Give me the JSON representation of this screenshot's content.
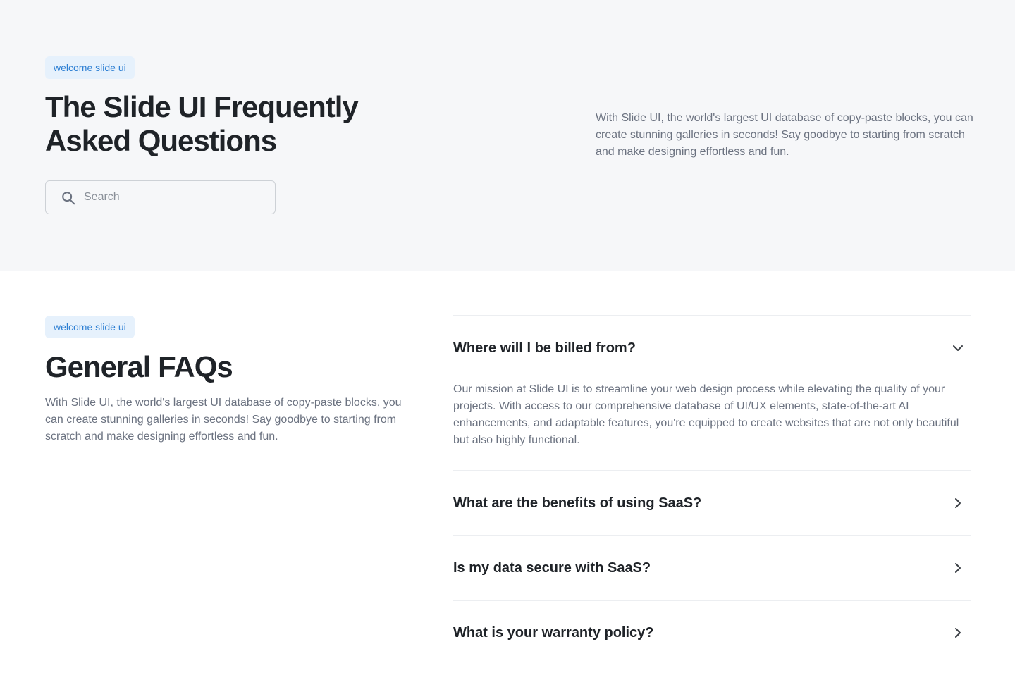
{
  "hero": {
    "badge": "welcome slide ui",
    "title": "The Slide UI Frequently Asked Questions",
    "search_placeholder": "Search",
    "description": "With Slide UI, the world's largest UI database of copy-paste blocks, you can create stunning galleries in seconds! Say goodbye to starting from scratch and make designing effortless and fun."
  },
  "faq_section": {
    "badge": "welcome slide ui",
    "title": "General FAQs",
    "description": "With Slide UI, the world's largest UI database of copy-paste blocks, you can create stunning galleries in seconds! Say goodbye to starting from scratch and make designing effortless and fun.",
    "items": [
      {
        "question": "Where will I be billed from?",
        "answer": "Our mission at Slide UI is to streamline your web design process while elevating the quality of your projects. With access to our comprehensive database of UI/UX elements, state-of-the-art AI enhancements, and adaptable features, you're equipped to create websites that are not only beautiful but also highly functional.",
        "expanded": true
      },
      {
        "question": "What are the benefits of using SaaS?",
        "expanded": false
      },
      {
        "question": "Is my data secure with SaaS?",
        "expanded": false
      },
      {
        "question": "What is your warranty policy?",
        "expanded": false
      }
    ]
  },
  "colors": {
    "accent": "#2d7fd3",
    "badge_bg": "#e6f1fc",
    "hero_bg": "#f6f7f9",
    "text": "#1f2328",
    "muted": "#6b7280"
  },
  "icons": {
    "search": "search-icon",
    "expanded": "chevron-down-icon",
    "collapsed": "chevron-right-icon"
  }
}
